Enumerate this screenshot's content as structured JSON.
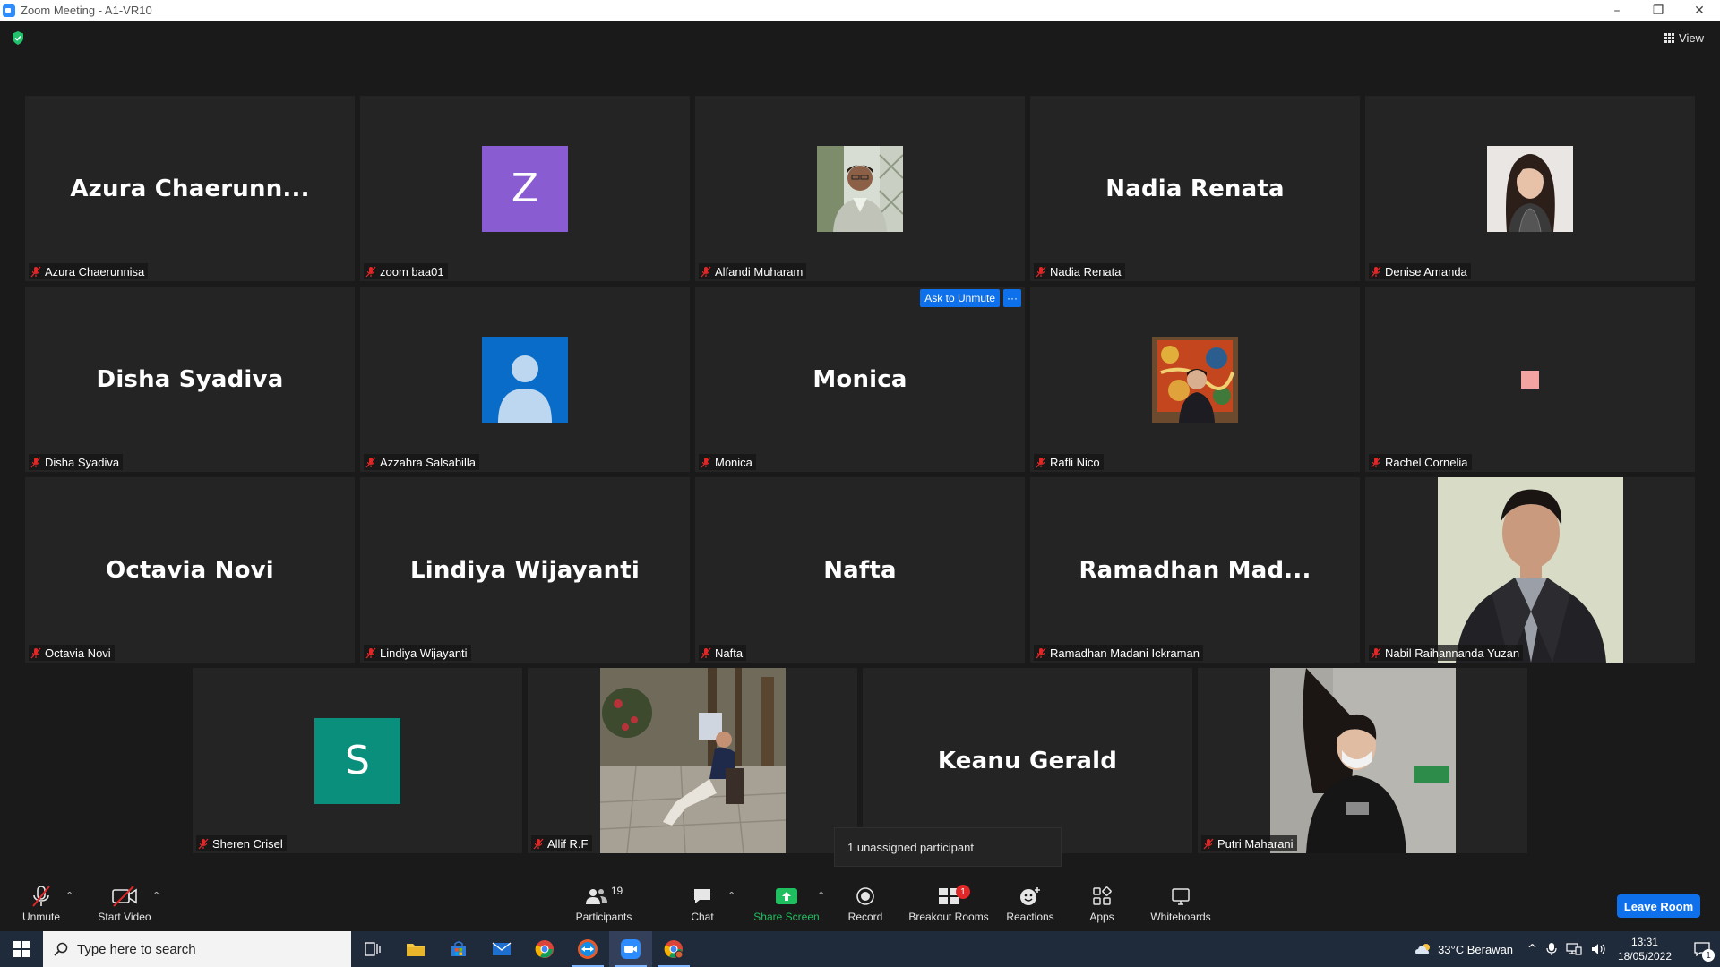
{
  "window": {
    "title": "Zoom Meeting - A1-VR10",
    "minimize": "–",
    "restore": "❐",
    "close": "✕"
  },
  "header": {
    "view_label": "View"
  },
  "tiles": [
    {
      "big": "Azura  Chaerunn...",
      "label": "Azura Chaerunnisa"
    },
    {
      "avatar": "Z",
      "label": "zoom baa01"
    },
    {
      "label": "Alfandi Muharam"
    },
    {
      "big": "Nadia Renata",
      "label": "Nadia Renata"
    },
    {
      "label": "Denise Amanda"
    },
    {
      "big": "Disha Syadiva",
      "label": "Disha Syadiva"
    },
    {
      "label": "Azzahra Salsabilla"
    },
    {
      "big": "Monica",
      "label": "Monica",
      "ask": "Ask to Unmute",
      "more": "···"
    },
    {
      "label": "Rafli Nico"
    },
    {
      "label": "Rachel Cornelia"
    },
    {
      "big": "Octavia Novi",
      "label": "Octavia Novi"
    },
    {
      "big": "Lindiya Wijayanti",
      "label": "Lindiya Wijayanti"
    },
    {
      "big": "Nafta",
      "label": "Nafta"
    },
    {
      "big": "Ramadhan  Mad...",
      "label": "Ramadhan Madani Ickraman"
    },
    {
      "label": "Nabil Raihannanda Yuzan"
    },
    {
      "avatar": "S",
      "label": "Sheren Crisel"
    },
    {
      "label": "Allif R.F"
    },
    {
      "big": "Keanu Gerald",
      "label": "Keanu Gerald"
    },
    {
      "label": "Putri Maharani"
    }
  ],
  "unassigned": "1 unassigned participant",
  "toolbar": {
    "unmute": "Unmute",
    "start_video": "Start Video",
    "participants": "Participants",
    "participants_count": "19",
    "chat": "Chat",
    "share_screen": "Share Screen",
    "record": "Record",
    "breakout_rooms": "Breakout Rooms",
    "breakout_badge": "1",
    "reactions": "Reactions",
    "apps": "Apps",
    "whiteboards": "Whiteboards",
    "leave_room": "Leave Room",
    "caret": "^"
  },
  "taskbar": {
    "search_placeholder": "Type here to search",
    "weather": "33°C  Berawan",
    "time": "13:31",
    "date": "18/05/2022",
    "notification_count": "1"
  },
  "colors": {
    "accent": "#0e71eb",
    "share_green": "#1fbf5f",
    "avatar_purple": "#8a5cd1",
    "avatar_teal": "#0a8f7d",
    "avatar_blue": "#0a6cc9",
    "mic_red": "#e02828"
  }
}
